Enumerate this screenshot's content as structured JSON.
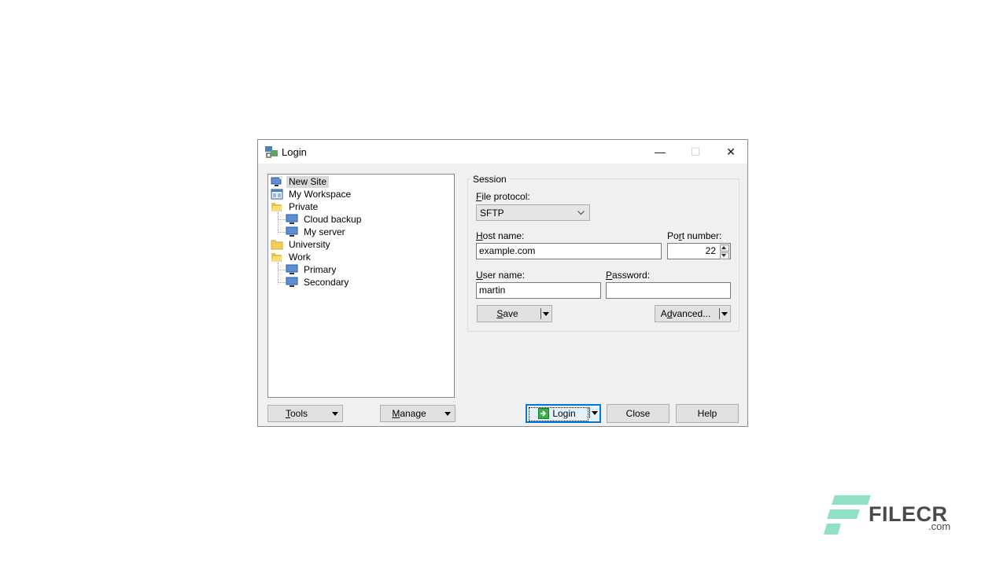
{
  "window": {
    "title": "Login",
    "controls": {
      "minimize": "—",
      "maximize": "☐",
      "close": "✕"
    }
  },
  "tree": {
    "items": [
      {
        "label": "New Site",
        "icon": "new-site-icon",
        "level": 0,
        "selected": true
      },
      {
        "label": "My Workspace",
        "icon": "workspace-icon",
        "level": 0
      },
      {
        "label": "Private",
        "icon": "folder-open-icon",
        "level": 0
      },
      {
        "label": "Cloud backup",
        "icon": "computer-icon",
        "level": 1
      },
      {
        "label": "My server",
        "icon": "computer-icon",
        "level": 1
      },
      {
        "label": "University",
        "icon": "folder-icon",
        "level": 0
      },
      {
        "label": "Work",
        "icon": "folder-open-icon",
        "level": 0
      },
      {
        "label": "Primary",
        "icon": "computer-icon",
        "level": 1
      },
      {
        "label": "Secondary",
        "icon": "computer-icon",
        "level": 1
      }
    ]
  },
  "session": {
    "group_label": "Session",
    "file_protocol_label_first": "F",
    "file_protocol_label_rest": "ile protocol:",
    "file_protocol_value": "SFTP",
    "host_label_first": "H",
    "host_label_rest": "ost name:",
    "host_value": "example.com",
    "port_label_pre": "Po",
    "port_label_u": "r",
    "port_label_rest": "t number:",
    "port_value": "22",
    "user_label_first": "U",
    "user_label_rest": "ser name:",
    "user_value": "martin",
    "password_label_first": "P",
    "password_label_rest": "assword:",
    "password_value": "",
    "save_first": "S",
    "save_rest": "ave",
    "advanced_pre": "A",
    "advanced_u": "d",
    "advanced_rest": "vanced..."
  },
  "footer": {
    "tools_first": "T",
    "tools_rest": "ools",
    "manage_first": "M",
    "manage_rest": "anage",
    "login": "Login",
    "close": "Close",
    "help": "Help"
  },
  "watermark": {
    "brand": "FILECR",
    "suffix": ".com"
  }
}
